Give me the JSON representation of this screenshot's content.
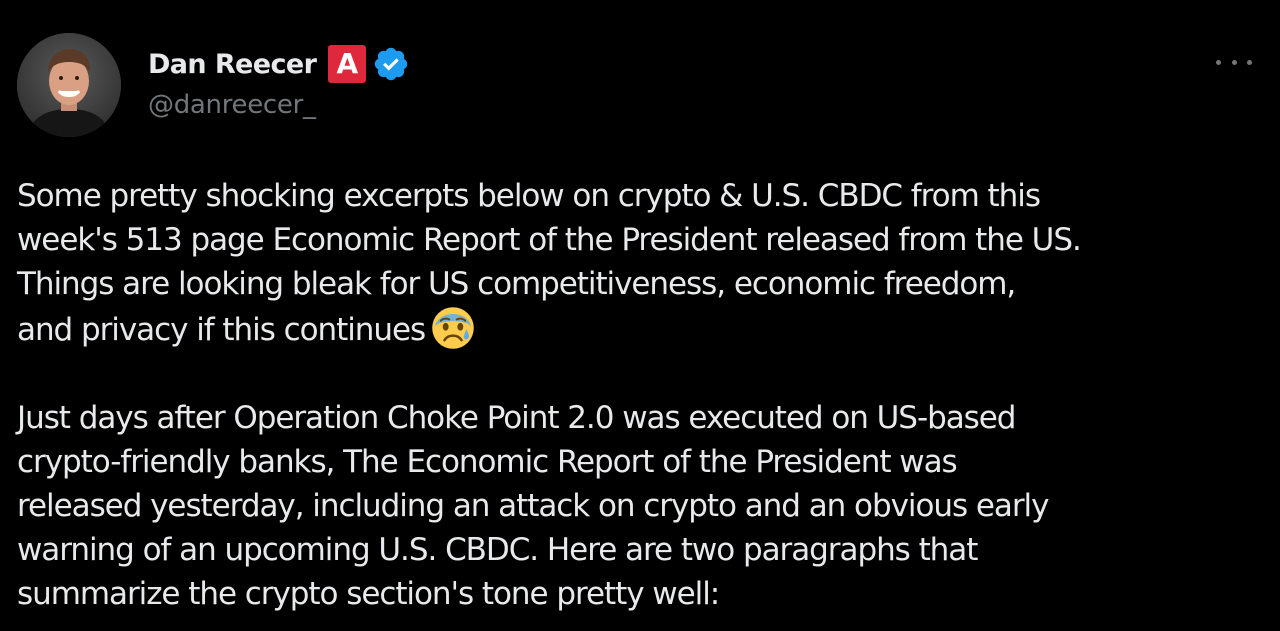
{
  "tweet": {
    "author": {
      "display_name": "Dan Reecer",
      "handle": "@danreecer_",
      "affiliation_badge_letter": "A",
      "affiliation_badge_color": "#e0283c",
      "verified_color": "#1d9bf0",
      "verified_icon": "verified-badge-icon",
      "avatar_icon": "avatar-photo"
    },
    "more_icon": "more-horizontal-icon",
    "body": {
      "paragraph_1_lines": [
        "Some pretty shocking excerpts below on crypto & U.S. CBDC from this",
        "week's 513 page Economic Report of the President released from the US.",
        "Things are looking bleak for US competitiveness, economic freedom,",
        "and privacy if this continues"
      ],
      "paragraph_1_emoji": "anxious-face-with-sweat-emoji",
      "paragraph_2_lines": [
        "Just days after Operation Choke Point 2.0 was executed on US-based",
        "crypto-friendly banks, The Economic Report of the President was",
        "released yesterday, including an attack on crypto and an obvious early",
        "warning of an upcoming U.S. CBDC. Here are two paragraphs that",
        "summarize the crypto section's tone pretty well:"
      ]
    },
    "colors": {
      "background": "#000000",
      "text_primary": "#e7e9ea",
      "text_secondary": "#71767b"
    }
  }
}
